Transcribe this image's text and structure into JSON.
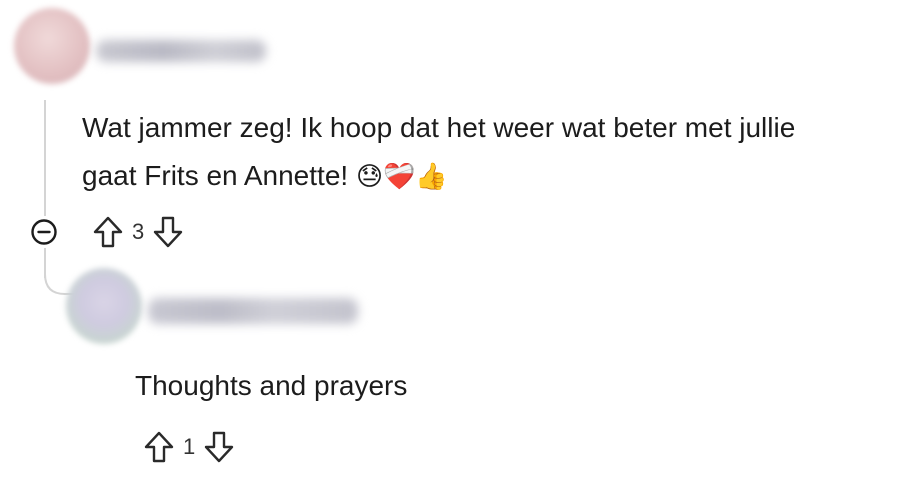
{
  "comments": [
    {
      "text_line1": "Wat jammer zeg! Ik hoop dat het weer wat beter met jullie",
      "text_line2": "gaat Frits en Annette!",
      "emojis": "😓❤️‍🩹👍",
      "score": "3"
    },
    {
      "text": "Thoughts and prayers",
      "score": "1"
    }
  ],
  "icons": {
    "upvote": "arrow-up-outline-icon",
    "downvote": "arrow-down-outline-icon",
    "collapse": "minus-circle-icon"
  }
}
